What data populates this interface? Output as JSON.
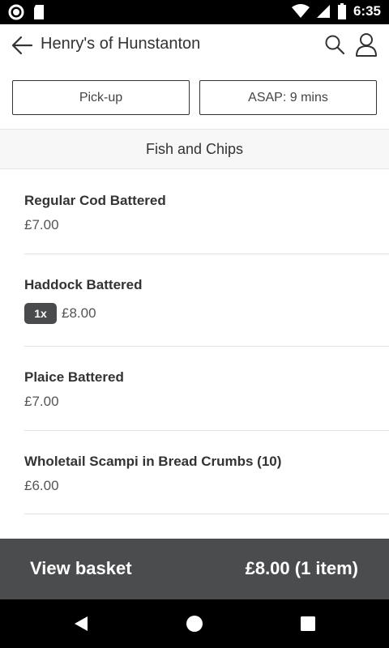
{
  "status_bar": {
    "time": "6:35"
  },
  "header": {
    "title": "Henry's of Hunstanton"
  },
  "options": {
    "pickup_label": "Pick-up",
    "time_label": "ASAP: 9 mins"
  },
  "category": {
    "name": "Fish and Chips"
  },
  "items": [
    {
      "name": "Regular Cod Battered",
      "price": "£7.00"
    },
    {
      "name": "Haddock Battered",
      "price": "£8.00",
      "quantity": "1x"
    },
    {
      "name": "Plaice Battered",
      "price": "£7.00"
    },
    {
      "name": "Wholetail Scampi in Bread Crumbs (10)",
      "price": "£6.00"
    }
  ],
  "basket": {
    "label": "View basket",
    "total": "£8.00 (1 item)"
  },
  "colors": {
    "basket_bg": "#4b4c4e",
    "qty_badge": "#4a4b4d",
    "status_bar": "#000000"
  }
}
